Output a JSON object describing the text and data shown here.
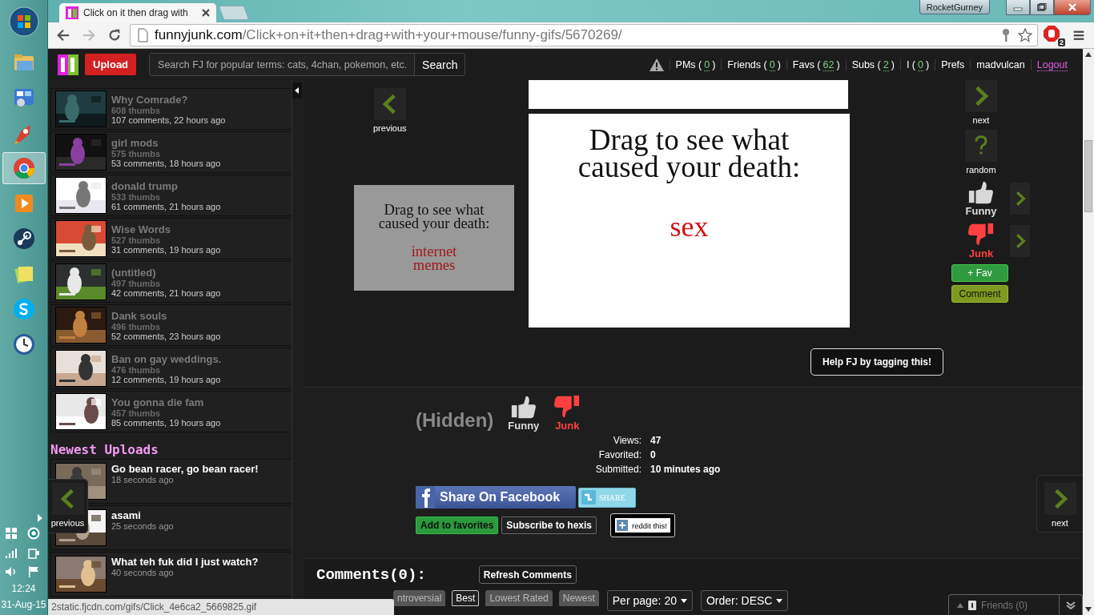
{
  "taskbar": {
    "apps": [
      {
        "kind": "folder",
        "selected": false
      },
      {
        "kind": "panel",
        "selected": false
      },
      {
        "kind": "rocket",
        "selected": false
      },
      {
        "kind": "chrome",
        "selected": true
      },
      {
        "kind": "media",
        "selected": false
      },
      {
        "kind": "steam",
        "selected": false
      },
      {
        "kind": "notes",
        "selected": false
      },
      {
        "kind": "skype",
        "selected": false
      },
      {
        "kind": "clock",
        "selected": false
      }
    ],
    "time": "12:24",
    "date": "31-Aug-15"
  },
  "browser": {
    "tab_title": "Click on it then drag with",
    "user": "RocketGurney",
    "url_host": "funnyjunk.com",
    "url_path": "/Click+on+it+then+drag+with+your+mouse/funny-gifs/5670269/",
    "extension_badge": "2"
  },
  "header": {
    "upload": "Upload",
    "search_placeholder": "Search FJ for popular terms: cats, 4chan, pokemon, etc.",
    "search_button": "Search",
    "links": [
      {
        "prefix": "PMs (",
        "count": "0",
        "suffix": ")"
      },
      {
        "prefix": "Friends (",
        "count": "0",
        "suffix": ")"
      },
      {
        "prefix": "Favs (",
        "count": "62",
        "suffix": ")"
      },
      {
        "prefix": "Subs (",
        "count": "2",
        "suffix": ")"
      },
      {
        "prefix": "I (",
        "count": "0",
        "suffix": ")"
      },
      {
        "prefix": "Prefs"
      },
      {
        "prefix": "madvulcan"
      }
    ],
    "logout": "Logout"
  },
  "sidebar": {
    "items": [
      {
        "title": "Why Comrade?",
        "thumbs": "608 thumbs",
        "comments": "107 comments, 22 hours ago"
      },
      {
        "title": "girl mods",
        "thumbs": "575 thumbs",
        "comments": "53 comments, 18 hours ago"
      },
      {
        "title": "donald trump",
        "thumbs": "533 thumbs",
        "comments": "61 comments, 21 hours ago"
      },
      {
        "title": "Wise Words",
        "thumbs": "527 thumbs",
        "comments": "31 comments, 19 hours ago"
      },
      {
        "title": "(untitled)",
        "thumbs": "497 thumbs",
        "comments": "42 comments, 21 hours ago"
      },
      {
        "title": "Dank souls",
        "thumbs": "496 thumbs",
        "comments": "52 comments, 23 hours ago"
      },
      {
        "title": "Ban on gay weddings.",
        "thumbs": "476 thumbs",
        "comments": "12 comments, 19 hours ago"
      },
      {
        "title": "You gonna die fam",
        "thumbs": "457 thumbs",
        "comments": "85 comments, 19 hours ago"
      }
    ],
    "newest_heading": "Newest Uploads",
    "newest": [
      {
        "title": "Go bean racer, go bean racer!",
        "time": "18 seconds ago"
      },
      {
        "title": "asami",
        "time": "25 seconds ago"
      },
      {
        "title": "What teh fuk did I just watch?",
        "time": "40 seconds ago"
      }
    ]
  },
  "post": {
    "previous": "previous",
    "next": "next",
    "random": "random",
    "small_card": {
      "lines": [
        "Drag to see what",
        "caused your death:"
      ],
      "answer": [
        "internet",
        "memes"
      ]
    },
    "main_card": {
      "lines": [
        "Drag to see what",
        "caused your death:"
      ],
      "answer": "sex"
    },
    "funny": "Funny",
    "junk": "Junk",
    "fav": "+ Fav",
    "comment": "Comment",
    "help": "Help FJ by tagging this!"
  },
  "details": {
    "rating": "(Hidden)",
    "funny": "Funny",
    "junk": "Junk",
    "stats": [
      {
        "label": "Views:",
        "value": "47"
      },
      {
        "label": "Favorited:",
        "value": "0"
      },
      {
        "label": "Submitted:",
        "value": "10 minutes ago"
      }
    ],
    "facebook": "Share On Facebook",
    "twitter": "SHARE",
    "add_favorites": "Add to favorites",
    "subscribe": "Subscribe to hexis",
    "reddit": "reddit this!"
  },
  "comments": {
    "heading": "Comments(0):",
    "refresh": "Refresh Comments",
    "sorts": [
      {
        "label": "ntroversial",
        "selected": false
      },
      {
        "label": "Best",
        "selected": true
      },
      {
        "label": "Lowest Rated",
        "selected": false
      },
      {
        "label": "Newest",
        "selected": false
      }
    ],
    "per_page": "Per page: 20",
    "order": "Order: DESC"
  },
  "floating": {
    "previous": "previous",
    "next": "next"
  },
  "status_bar": "2static.fjcdn.com/gifs/Click_4e6ca2_5669825.gif",
  "friends_bar": "Friends (0)"
}
